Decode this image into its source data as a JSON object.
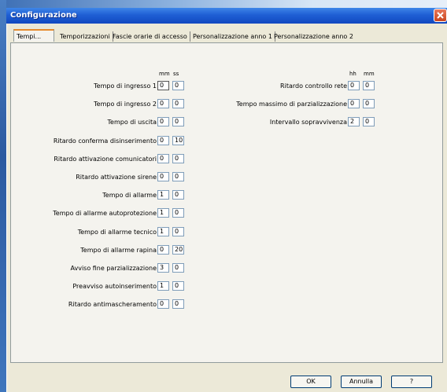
{
  "window": {
    "title": "Configurazione"
  },
  "tabs": [
    {
      "label": "Tempi..."
    },
    {
      "label": "Temporizzazioni"
    },
    {
      "label": "Fascie orarie di accesso"
    },
    {
      "label": "Personalizzazione anno 1"
    },
    {
      "label": "Personalizzazione anno 2"
    }
  ],
  "left_group": {
    "headers": {
      "mm": "mm",
      "ss": "ss"
    },
    "rows": [
      {
        "label": "Tempo di ingresso 1",
        "v1": "0",
        "v2": "0"
      },
      {
        "label": "Tempo di ingresso 2",
        "v1": "0",
        "v2": "0"
      },
      {
        "label": "Tempo di uscita",
        "v1": "0",
        "v2": "0"
      },
      {
        "label": "Ritardo conferma disinserimento",
        "v1": "0",
        "v2": "10"
      },
      {
        "label": "Ritardo attivazione comunicatori",
        "v1": "0",
        "v2": "0"
      },
      {
        "label": "Ritardo attivazione sirene",
        "v1": "0",
        "v2": "0"
      },
      {
        "label": "Tempo di allarme",
        "v1": "1",
        "v2": "0"
      },
      {
        "label": "Tempo di allarme autoprotezione",
        "v1": "1",
        "v2": "0"
      },
      {
        "label": "Tempo di allarme tecnico",
        "v1": "1",
        "v2": "0"
      },
      {
        "label": "Tempo di allarme rapina",
        "v1": "0",
        "v2": "20"
      },
      {
        "label": "Avviso fine parzializzazione",
        "v1": "3",
        "v2": "0"
      },
      {
        "label": "Preavviso autoinserimento",
        "v1": "1",
        "v2": "0"
      },
      {
        "label": "Ritardo antimascheramento",
        "v1": "0",
        "v2": "0"
      }
    ]
  },
  "right_group": {
    "headers": {
      "hh": "hh",
      "mm": "mm"
    },
    "rows": [
      {
        "label": "Ritardo controllo rete",
        "v1": "0",
        "v2": "0"
      },
      {
        "label": "Tempo massimo di parzializzazione",
        "v1": "0",
        "v2": "0"
      },
      {
        "label": "Intervallo sopravvivenza",
        "v1": "2",
        "v2": "0"
      }
    ]
  },
  "buttons": {
    "ok": "OK",
    "cancel": "Annulla",
    "help": "?"
  }
}
